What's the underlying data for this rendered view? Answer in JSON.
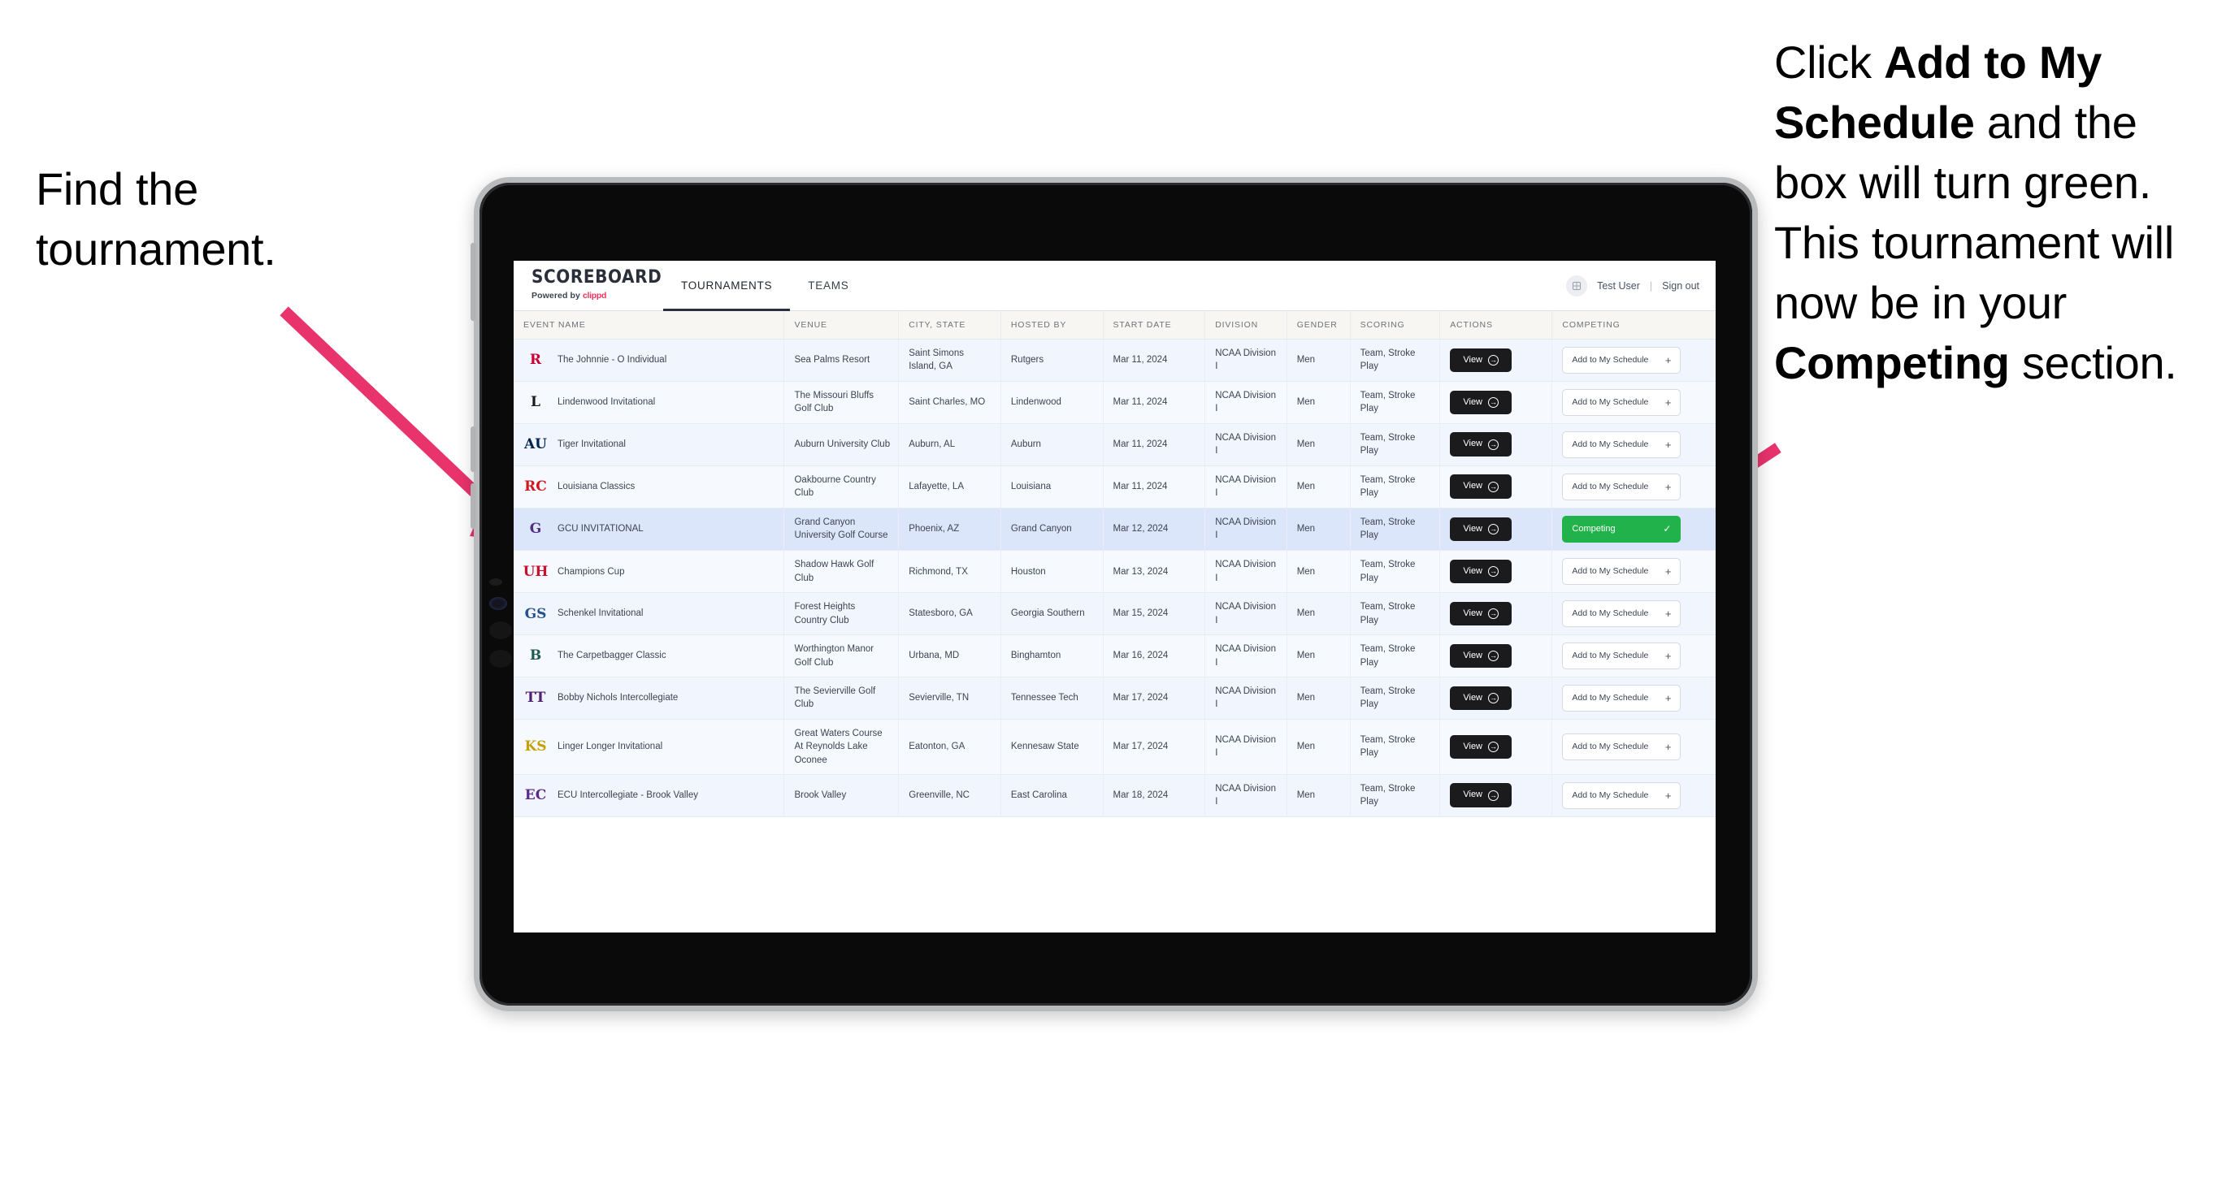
{
  "annotations": {
    "left": {
      "line1": "Find the",
      "line2": "tournament."
    },
    "right": {
      "p1_pre": "Click ",
      "p1_bold": "Add to My Schedule",
      "p1_post": " and the box will turn green. This tournament will now be in your ",
      "p2_bold": "Competing",
      "p2_post": " section."
    },
    "arrow_color": "#e8336d"
  },
  "app": {
    "brand": {
      "name": "SCOREBOARD",
      "sub_prefix": "Powered by ",
      "sub_brand": "clippd"
    },
    "tabs": [
      {
        "label": "TOURNAMENTS",
        "active": true
      },
      {
        "label": "TEAMS",
        "active": false
      }
    ],
    "header_right": {
      "avatar_icon": "user-avatar-icon",
      "user": "Test User",
      "separator": "|",
      "signout": "Sign out"
    },
    "accent_green": "#22b24c",
    "accent_brand_red": "#f0325a"
  },
  "table": {
    "columns": [
      "EVENT NAME",
      "VENUE",
      "CITY, STATE",
      "HOSTED BY",
      "START DATE",
      "DIVISION",
      "GENDER",
      "SCORING",
      "ACTIONS",
      "COMPETING"
    ],
    "view_label": "View",
    "add_label": "Add to My Schedule",
    "add_plus": "+",
    "competing_label": "Competing",
    "competing_check": "✓",
    "rows": [
      {
        "event": "The Johnnie - O Individual",
        "logo": {
          "name": "rutgers-logo",
          "text": "R",
          "color": "#cc0033",
          "bg": "transparent"
        },
        "venue": "Sea Palms Resort",
        "city": "Saint Simons Island, GA",
        "host": "Rutgers",
        "date": "Mar 11, 2024",
        "division": "NCAA Division I",
        "gender": "Men",
        "scoring": "Team, Stroke Play",
        "competing": false,
        "selected": false
      },
      {
        "event": "Lindenwood Invitational",
        "logo": {
          "name": "lindenwood-logo",
          "text": "L",
          "color": "#1a1a1a",
          "bg": "transparent"
        },
        "venue": "The Missouri Bluffs Golf Club",
        "city": "Saint Charles, MO",
        "host": "Lindenwood",
        "date": "Mar 11, 2024",
        "division": "NCAA Division I",
        "gender": "Men",
        "scoring": "Team, Stroke Play",
        "competing": false,
        "selected": false
      },
      {
        "event": "Tiger Invitational",
        "logo": {
          "name": "auburn-logo",
          "text": "AU",
          "color": "#03244d",
          "bg": "transparent"
        },
        "venue": "Auburn University Club",
        "city": "Auburn, AL",
        "host": "Auburn",
        "date": "Mar 11, 2024",
        "division": "NCAA Division I",
        "gender": "Men",
        "scoring": "Team, Stroke Play",
        "competing": false,
        "selected": false
      },
      {
        "event": "Louisiana Classics",
        "logo": {
          "name": "louisiana-ragin-cajuns-logo",
          "text": "RC",
          "color": "#ce181e",
          "bg": "transparent"
        },
        "venue": "Oakbourne Country Club",
        "city": "Lafayette, LA",
        "host": "Louisiana",
        "date": "Mar 11, 2024",
        "division": "NCAA Division I",
        "gender": "Men",
        "scoring": "Team, Stroke Play",
        "competing": false,
        "selected": false
      },
      {
        "event": "GCU INVITATIONAL",
        "logo": {
          "name": "grand-canyon-lopes-logo",
          "text": "G",
          "color": "#522d80",
          "bg": "transparent"
        },
        "venue": "Grand Canyon University Golf Course",
        "city": "Phoenix, AZ",
        "host": "Grand Canyon",
        "date": "Mar 12, 2024",
        "division": "NCAA Division I",
        "gender": "Men",
        "scoring": "Team, Stroke Play",
        "competing": true,
        "selected": true
      },
      {
        "event": "Champions Cup",
        "logo": {
          "name": "houston-cougars-logo",
          "text": "UH",
          "color": "#c8102e",
          "bg": "transparent"
        },
        "venue": "Shadow Hawk Golf Club",
        "city": "Richmond, TX",
        "host": "Houston",
        "date": "Mar 13, 2024",
        "division": "NCAA Division I",
        "gender": "Men",
        "scoring": "Team, Stroke Play",
        "competing": false,
        "selected": false
      },
      {
        "event": "Schenkel Invitational",
        "logo": {
          "name": "georgia-southern-eagles-logo",
          "text": "GS",
          "color": "#27518b",
          "bg": "transparent"
        },
        "venue": "Forest Heights Country Club",
        "city": "Statesboro, GA",
        "host": "Georgia Southern",
        "date": "Mar 15, 2024",
        "division": "NCAA Division I",
        "gender": "Men",
        "scoring": "Team, Stroke Play",
        "competing": false,
        "selected": false
      },
      {
        "event": "The Carpetbagger Classic",
        "logo": {
          "name": "binghamton-bearcats-logo",
          "text": "B",
          "color": "#1d5c4f",
          "bg": "transparent"
        },
        "venue": "Worthington Manor Golf Club",
        "city": "Urbana, MD",
        "host": "Binghamton",
        "date": "Mar 16, 2024",
        "division": "NCAA Division I",
        "gender": "Men",
        "scoring": "Team, Stroke Play",
        "competing": false,
        "selected": false
      },
      {
        "event": "Bobby Nichols Intercollegiate",
        "logo": {
          "name": "tennessee-tech-golden-eagles-logo",
          "text": "TT",
          "color": "#4f2170",
          "bg": "transparent"
        },
        "venue": "The Sevierville Golf Club",
        "city": "Sevierville, TN",
        "host": "Tennessee Tech",
        "date": "Mar 17, 2024",
        "division": "NCAA Division I",
        "gender": "Men",
        "scoring": "Team, Stroke Play",
        "competing": false,
        "selected": false
      },
      {
        "event": "Linger Longer Invitational",
        "logo": {
          "name": "kennesaw-state-owls-logo",
          "text": "KS",
          "color": "#c5a005",
          "bg": "transparent"
        },
        "venue": "Great Waters Course At Reynolds Lake Oconee",
        "city": "Eatonton, GA",
        "host": "Kennesaw State",
        "date": "Mar 17, 2024",
        "division": "NCAA Division I",
        "gender": "Men",
        "scoring": "Team, Stroke Play",
        "competing": false,
        "selected": false
      },
      {
        "event": "ECU Intercollegiate - Brook Valley",
        "logo": {
          "name": "east-carolina-pirates-logo",
          "text": "EC",
          "color": "#592a8a",
          "bg": "transparent"
        },
        "venue": "Brook Valley",
        "city": "Greenville, NC",
        "host": "East Carolina",
        "date": "Mar 18, 2024",
        "division": "NCAA Division I",
        "gender": "Men",
        "scoring": "Team, Stroke Play",
        "competing": false,
        "selected": false
      }
    ]
  }
}
